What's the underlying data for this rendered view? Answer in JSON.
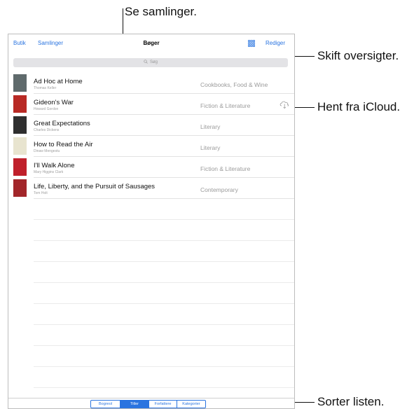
{
  "callouts": {
    "collections": "Se samlinger.",
    "views": "Skift oversigter.",
    "icloud": "Hent fra iCloud.",
    "sort": "Sorter listen."
  },
  "nav": {
    "store": "Butik",
    "collections": "Samlinger",
    "title": "Bøger",
    "edit": "Rediger",
    "view_icon": "grid-view-icon"
  },
  "search": {
    "placeholder": "Søg",
    "icon": "search-icon"
  },
  "books": [
    {
      "title": "Ad Hoc at Home",
      "author": "Thomas Keller",
      "category": "Cookbooks, Food & Wine",
      "cover_color": "#5f6a6c",
      "icloud": false
    },
    {
      "title": "Gideon's War",
      "author": "Howard Gordon",
      "category": "Fiction & Literature",
      "cover_color": "#b82a25",
      "icloud": true
    },
    {
      "title": "Great Expectations",
      "author": "Charles Dickens",
      "category": "Literary",
      "cover_color": "#2f2f2f",
      "icloud": false
    },
    {
      "title": "How to Read the Air",
      "author": "Dinaw Mengestu",
      "category": "Literary",
      "cover_color": "#e8e4cf",
      "icloud": false
    },
    {
      "title": "I'll Walk Alone",
      "author": "Mary Higgins Clark",
      "category": "Fiction & Literature",
      "cover_color": "#c0202b",
      "icloud": false
    },
    {
      "title": "Life, Liberty, and the Pursuit of Sausages",
      "author": "Tom Holt",
      "category": "Contemporary",
      "cover_color": "#a2262a",
      "icloud": false
    }
  ],
  "sort_tabs": [
    {
      "label": "Bogreol",
      "active": false
    },
    {
      "label": "Titler",
      "active": true
    },
    {
      "label": "Forfattere",
      "active": false
    },
    {
      "label": "Kategorier",
      "active": false
    }
  ],
  "colors": {
    "accent": "#2a74e0",
    "separator": "#e2e2e2",
    "search_bg": "#e3e3e6"
  }
}
